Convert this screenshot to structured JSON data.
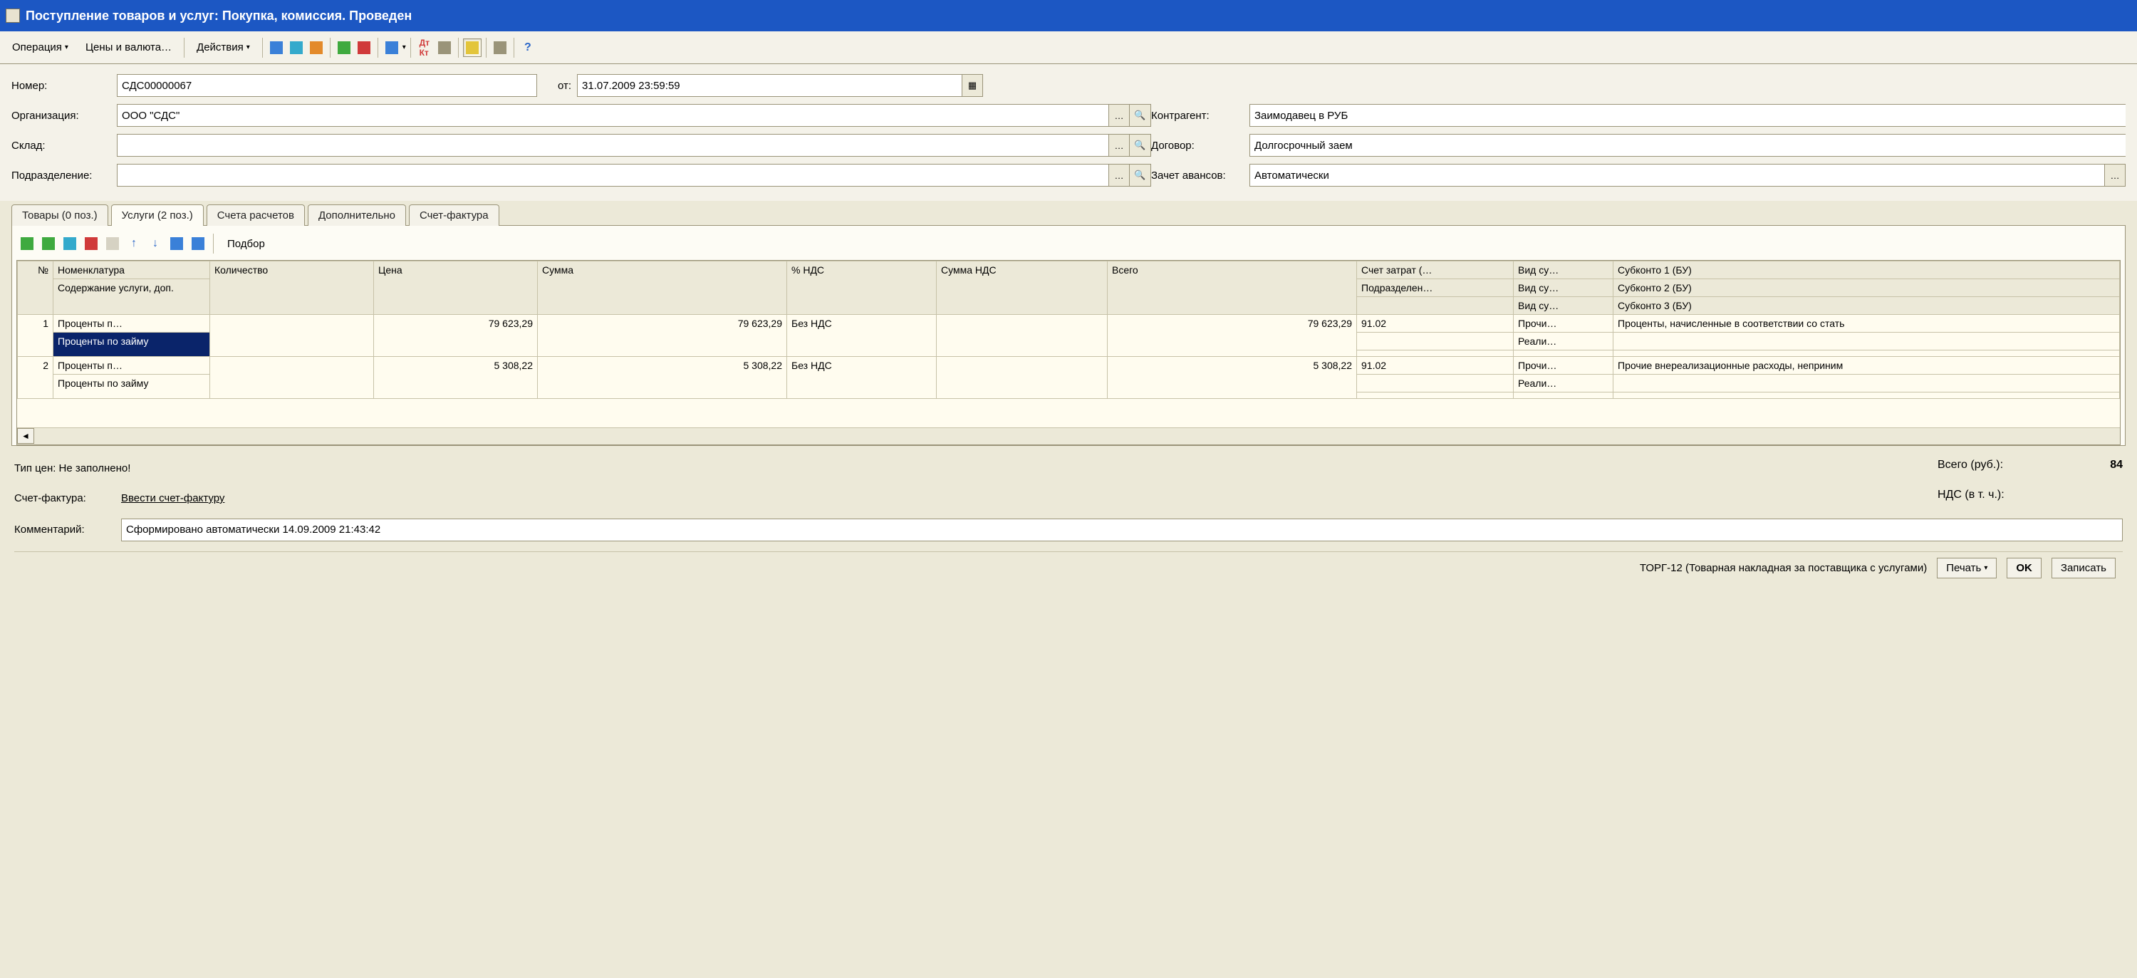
{
  "titlebar": "Поступление товаров и услуг: Покупка, комиссия. Проведен",
  "toolbar": {
    "operation": "Операция",
    "prices": "Цены и валюта…",
    "actions": "Действия"
  },
  "form": {
    "number_label": "Номер:",
    "number_value": "СДС00000067",
    "from_label": "от:",
    "from_value": "31.07.2009 23:59:59",
    "org_label": "Организация:",
    "org_value": "ООО \"СДС\"",
    "warehouse_label": "Склад:",
    "warehouse_value": "",
    "department_label": "Подразделение:",
    "department_value": "",
    "contractor_label": "Контрагент:",
    "contractor_value": "Заимодавец в РУБ",
    "contract_label": "Договор:",
    "contract_value": "Долгосрочный заем",
    "advance_label": "Зачет авансов:",
    "advance_value": "Автоматически"
  },
  "tabs": {
    "goods": "Товары (0 поз.)",
    "services": "Услуги (2 поз.)",
    "accounts": "Счета расчетов",
    "additional": "Дополнительно",
    "invoice": "Счет-фактура"
  },
  "panel_toolbar": {
    "select_btn": "Подбор"
  },
  "grid": {
    "headers": {
      "n": "№",
      "nomen": "Номенклатура",
      "desc": "Содержание услуги, доп.",
      "qty": "Количество",
      "price": "Цена",
      "sum": "Сумма",
      "vat_pct": "% НДС",
      "vat_sum": "Сумма НДС",
      "total": "Всего",
      "cost_acc": "Счет затрат (…",
      "dept": "Подразделен…",
      "kind1": "Вид су…",
      "kind2": "Вид су…",
      "kind3": "Вид су…",
      "sub1": "Субконто 1 (БУ)",
      "sub2": "Субконто 2 (БУ)",
      "sub3": "Субконто 3 (БУ)"
    },
    "rows": [
      {
        "n": "1",
        "nomen": "Проценты п…",
        "desc": "Проценты по займу",
        "price": "79 623,29",
        "sum": "79 623,29",
        "vat_pct": "Без НДС",
        "total": "79 623,29",
        "cost_acc": "91.02",
        "kind1": "Прочи…",
        "kind2": "Реали…",
        "sub1": "Проценты, начисленные в соответствии со стать"
      },
      {
        "n": "2",
        "nomen": "Проценты п…",
        "desc": "Проценты по займу",
        "price": "5 308,22",
        "sum": "5 308,22",
        "vat_pct": "Без НДС",
        "total": "5 308,22",
        "cost_acc": "91.02",
        "kind1": "Прочи…",
        "kind2": "Реали…",
        "sub1": "Прочие внереализационные расходы, неприним"
      }
    ]
  },
  "bottom": {
    "price_type": "Тип цен: Не заполнено!",
    "invoice_label": "Счет-фактура:",
    "invoice_link": "Ввести счет-фактуру",
    "comment_label": "Комментарий:",
    "comment_value": "Сформировано автоматически 14.09.2009 21:43:42",
    "totals_total_label": "Всего (руб.):",
    "totals_total_value": "84",
    "totals_vat_label": "НДС (в т. ч.):"
  },
  "statusbar": {
    "form_name": "ТОРГ-12 (Товарная накладная за поставщика с услугами)",
    "print": "Печать",
    "ok": "OK",
    "save": "Записать"
  }
}
